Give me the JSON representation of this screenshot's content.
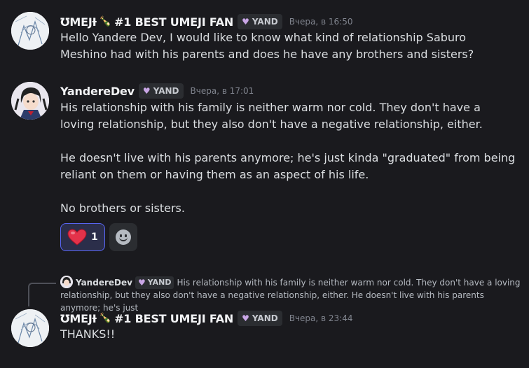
{
  "messages": [
    {
      "username": "ƱMEJƗ",
      "badge": "#1 BEST UMEJI FAN",
      "role": "YAND",
      "timestamp": "Вчера, в 16:50",
      "text": "Hello Yandere Dev, I would like to know what kind of relationship Saburo Meshino had with his parents and does he have any brothers and sisters?"
    },
    {
      "username": "YandereDev",
      "role": "YAND",
      "timestamp": "Вчера, в 17:01",
      "paragraphs": [
        "His relationship with his family is neither warm nor cold. They don't have a loving relationship, but they also don't have a negative relationship, either.",
        "He doesn't live with his parents anymore; he's just kinda \"graduated\" from being reliant on them or having them as an aspect of his life.",
        "No brothers or sisters."
      ],
      "reaction": {
        "emoji": "heart",
        "count": "1"
      }
    },
    {
      "reply_to": {
        "username": "YandereDev",
        "role": "YAND",
        "preview": "His relationship with his family is neither warm nor cold. They don't have a loving relationship, but they also don't have a negative relationship, either.  He doesn't live with his parents anymore; he's just"
      },
      "username": "ƱMEJƗ",
      "badge": "#1 BEST UMEJI FAN",
      "role": "YAND",
      "timestamp": "Вчера, в 23:44",
      "text": "THANKS!!"
    }
  ],
  "colors": {
    "background": "#1a1a1e",
    "accent": "#5865f2",
    "heart": "#e4324a",
    "role_heart": "#c9a6e6"
  },
  "icons": [
    "bottle-icon",
    "heart-role-icon",
    "heart-reaction-icon",
    "add-reaction-icon"
  ]
}
